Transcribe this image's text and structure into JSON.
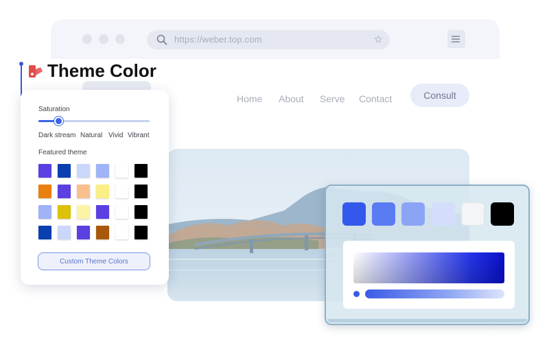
{
  "browser": {
    "url": "https://weber.top.com",
    "nav": [
      "Home",
      "About",
      "Serve",
      "Contact"
    ],
    "cta": "Consult"
  },
  "title": "Theme Color",
  "panel": {
    "saturation_label": "Saturation",
    "saturation_level": 0.18,
    "saturation_options": [
      "Dark stream",
      "Natural",
      "Vivid",
      "Vibrant"
    ],
    "featured_label": "Featured theme",
    "featured_themes": [
      [
        "#5b3fe0",
        "#0a3fb0",
        "#cbd6fb",
        "#9fb3f6",
        "#ffffff",
        "#000000"
      ],
      [
        "#ea7f0e",
        "#5b3fe0",
        "#f9c08e",
        "#fbee84",
        "#ffffff",
        "#000000"
      ],
      [
        "#9fb3f6",
        "#dcc20a",
        "#fbf4a4",
        "#5b3fe0",
        "#ffffff",
        "#000000"
      ],
      [
        "#0a3fb0",
        "#cbd6fb",
        "#5b3fe0",
        "#a8580b",
        "#ffffff",
        "#000000"
      ]
    ],
    "custom_button": "Custom Theme Colors"
  },
  "color_card": {
    "swatches": [
      "#3458ec",
      "#5a7cf2",
      "#8ca4f6",
      "#d4defc",
      "#f4f5f7",
      "#000000"
    ]
  },
  "colors": {
    "accent": "#3b63e8",
    "title_icon": "#e34b4b"
  }
}
